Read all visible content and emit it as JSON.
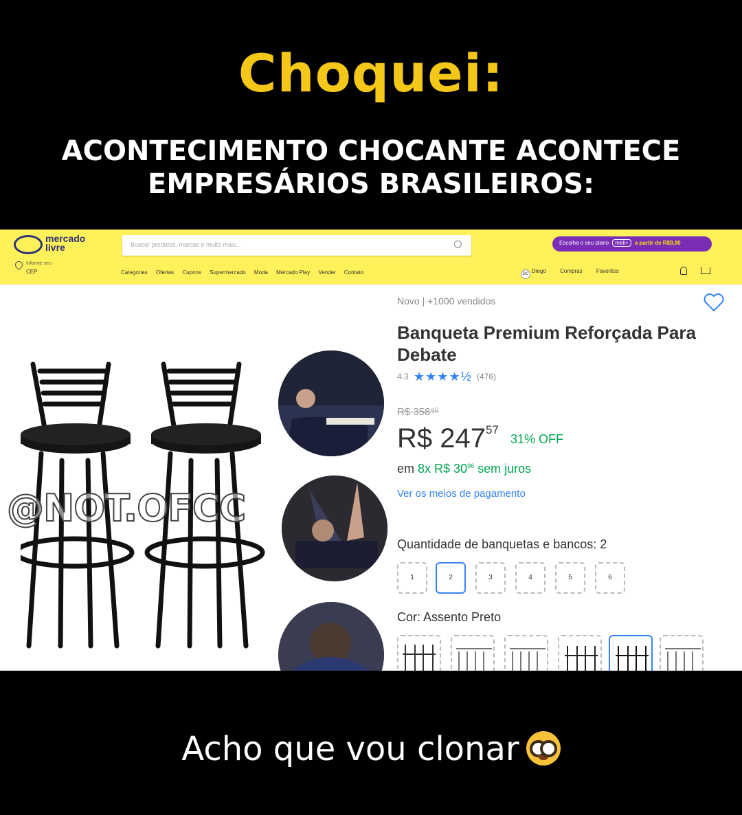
{
  "meme": {
    "title": "Choquei:",
    "subtitle": "ACONTECIMENTO CHOCANTE ACONTECE EMPRESÁRIOS BRASILEIROS:",
    "footer": "Acho que vou clonar",
    "footer_emoji": "nerd-face",
    "watermark": "@NOT.OFCC"
  },
  "header": {
    "logo_line1": "mercado",
    "logo_line2": "livre",
    "search_placeholder": "Buscar produtos, marcas e muito mais...",
    "promo_text": "Escolha o seu plano",
    "promo_badge": "meli+",
    "promo_price": "a partir de R$9,90",
    "cep_line1": "Informe seu",
    "cep_line2": "CEP",
    "nav": [
      "Categorias",
      "Ofertas",
      "Cupons",
      "Supermercado",
      "Moda",
      "Mercado Play",
      "Vender",
      "Contato"
    ],
    "user_name": "Diego",
    "user_links": [
      "Compras",
      "Favoritos"
    ],
    "accent": "#fff159"
  },
  "product": {
    "condition": "Novo | +1000 vendidos",
    "title": "Banqueta  Premium Reforçada Para Debate",
    "rating_value": "4.3",
    "stars": "★★★★½",
    "rating_count": "(476)",
    "old_price": "R$ 358⁹⁰",
    "price_main": "R$ 247",
    "price_cents": "57",
    "discount": "31% OFF",
    "installments_prefix": "em",
    "installments_value": "8x R$ 30",
    "installments_cents": "96",
    "installments_suffix": "sem juros",
    "payment_link": "Ver os meios de pagamento",
    "quantity_label": "Quantidade de banquetas e bancos: 2",
    "quantities": [
      "1",
      "2",
      "3",
      "4",
      "5",
      "6"
    ],
    "selected_quantity": "2",
    "color_label": "Cor: Assento Preto",
    "price_color": "#00a650",
    "link_color": "#3483fa"
  }
}
